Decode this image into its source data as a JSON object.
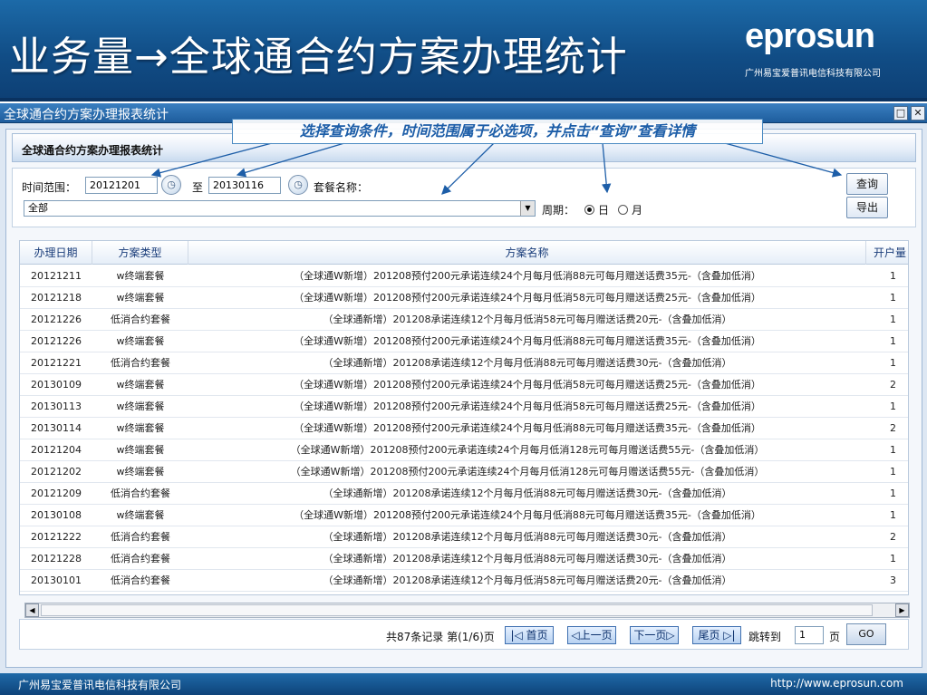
{
  "slide": {
    "title": "业务量→全球通合约方案办理统计",
    "logo": "eprosun",
    "logo_sub": "广州易宝爱普讯电信科技有限公司",
    "footer_left": "广州易宝爱普讯电信科技有限公司",
    "footer_right": "http://www.eprosun.com"
  },
  "window": {
    "title": "全球通合约方案办理报表统计",
    "restore_glyph": "□",
    "close_glyph": "✕"
  },
  "tab": {
    "title": "全球通合约方案办理报表统计"
  },
  "callout": "选择查询条件，时间范围属于必选项，并点击“查询”查看详情",
  "filters": {
    "time_range_label": "时间范围：",
    "start_date": "20121201",
    "to_label": "至",
    "end_date": "20130116",
    "package_label": "套餐名称：",
    "scope_value": "全部",
    "period_label": "周期：",
    "period_day": "日",
    "period_month": "月",
    "selected_period": "日",
    "query_label": "查询",
    "export_label": "导出"
  },
  "table": {
    "columns": [
      "办理日期",
      "方案类型",
      "方案名称",
      "开户量"
    ],
    "rows": [
      [
        "20121211",
        "w终端套餐",
        "（全球通W新增）201208预付200元承诺连续24个月每月低消88元可每月赠送话费35元-（含叠加低消）",
        "1"
      ],
      [
        "20121218",
        "w终端套餐",
        "（全球通W新增）201208预付200元承诺连续24个月每月低消58元可每月赠送话费25元-（含叠加低消）",
        "1"
      ],
      [
        "20121226",
        "低消合约套餐",
        "（全球通新增）201208承诺连续12个月每月低消58元可每月赠送话费20元-（含叠加低消）",
        "1"
      ],
      [
        "20121226",
        "w终端套餐",
        "（全球通W新增）201208预付200元承诺连续24个月每月低消88元可每月赠送话费35元-（含叠加低消）",
        "1"
      ],
      [
        "20121221",
        "低消合约套餐",
        "（全球通新增）201208承诺连续12个月每月低消88元可每月赠送话费30元-（含叠加低消）",
        "1"
      ],
      [
        "20130109",
        "w终端套餐",
        "（全球通W新增）201208预付200元承诺连续24个月每月低消58元可每月赠送话费25元-（含叠加低消）",
        "2"
      ],
      [
        "20130113",
        "w终端套餐",
        "（全球通W新增）201208预付200元承诺连续24个月每月低消58元可每月赠送话费25元-（含叠加低消）",
        "1"
      ],
      [
        "20130114",
        "w终端套餐",
        "（全球通W新增）201208预付200元承诺连续24个月每月低消88元可每月赠送话费35元-（含叠加低消）",
        "2"
      ],
      [
        "20121204",
        "w终端套餐",
        "（全球通W新增）201208预付200元承诺连续24个月每月低消128元可每月赠送话费55元-（含叠加低消）",
        "1"
      ],
      [
        "20121202",
        "w终端套餐",
        "（全球通W新增）201208预付200元承诺连续24个月每月低消128元可每月赠送话费55元-（含叠加低消）",
        "1"
      ],
      [
        "20121209",
        "低消合约套餐",
        "（全球通新增）201208承诺连续12个月每月低消88元可每月赠送话费30元-（含叠加低消）",
        "1"
      ],
      [
        "20130108",
        "w终端套餐",
        "（全球通W新增）201208预付200元承诺连续24个月每月低消88元可每月赠送话费35元-（含叠加低消）",
        "1"
      ],
      [
        "20121222",
        "低消合约套餐",
        "（全球通新增）201208承诺连续12个月每月低消88元可每月赠送话费30元-（含叠加低消）",
        "2"
      ],
      [
        "20121228",
        "低消合约套餐",
        "（全球通新增）201208承诺连续12个月每月低消88元可每月赠送话费30元-（含叠加低消）",
        "1"
      ],
      [
        "20130101",
        "低消合约套餐",
        "（全球通新增）201208承诺连续12个月每月低消58元可每月赠送话费20元-（含叠加低消）",
        "3"
      ]
    ]
  },
  "pager": {
    "summary": "共87条记录 第(1/6)页",
    "first": "|◁ 首页",
    "prev": "◁上一页",
    "next": "下一页▷",
    "last": "尾页 ▷|",
    "jump_label": "跳转到",
    "page_value": "1",
    "page_unit": "页",
    "go": "GO"
  },
  "colors": {
    "header_blue": "#114d86",
    "callout_text": "#1d5ea8",
    "grid_header_text": "#1a3d7a",
    "pager_button": "#b8d2f1"
  }
}
